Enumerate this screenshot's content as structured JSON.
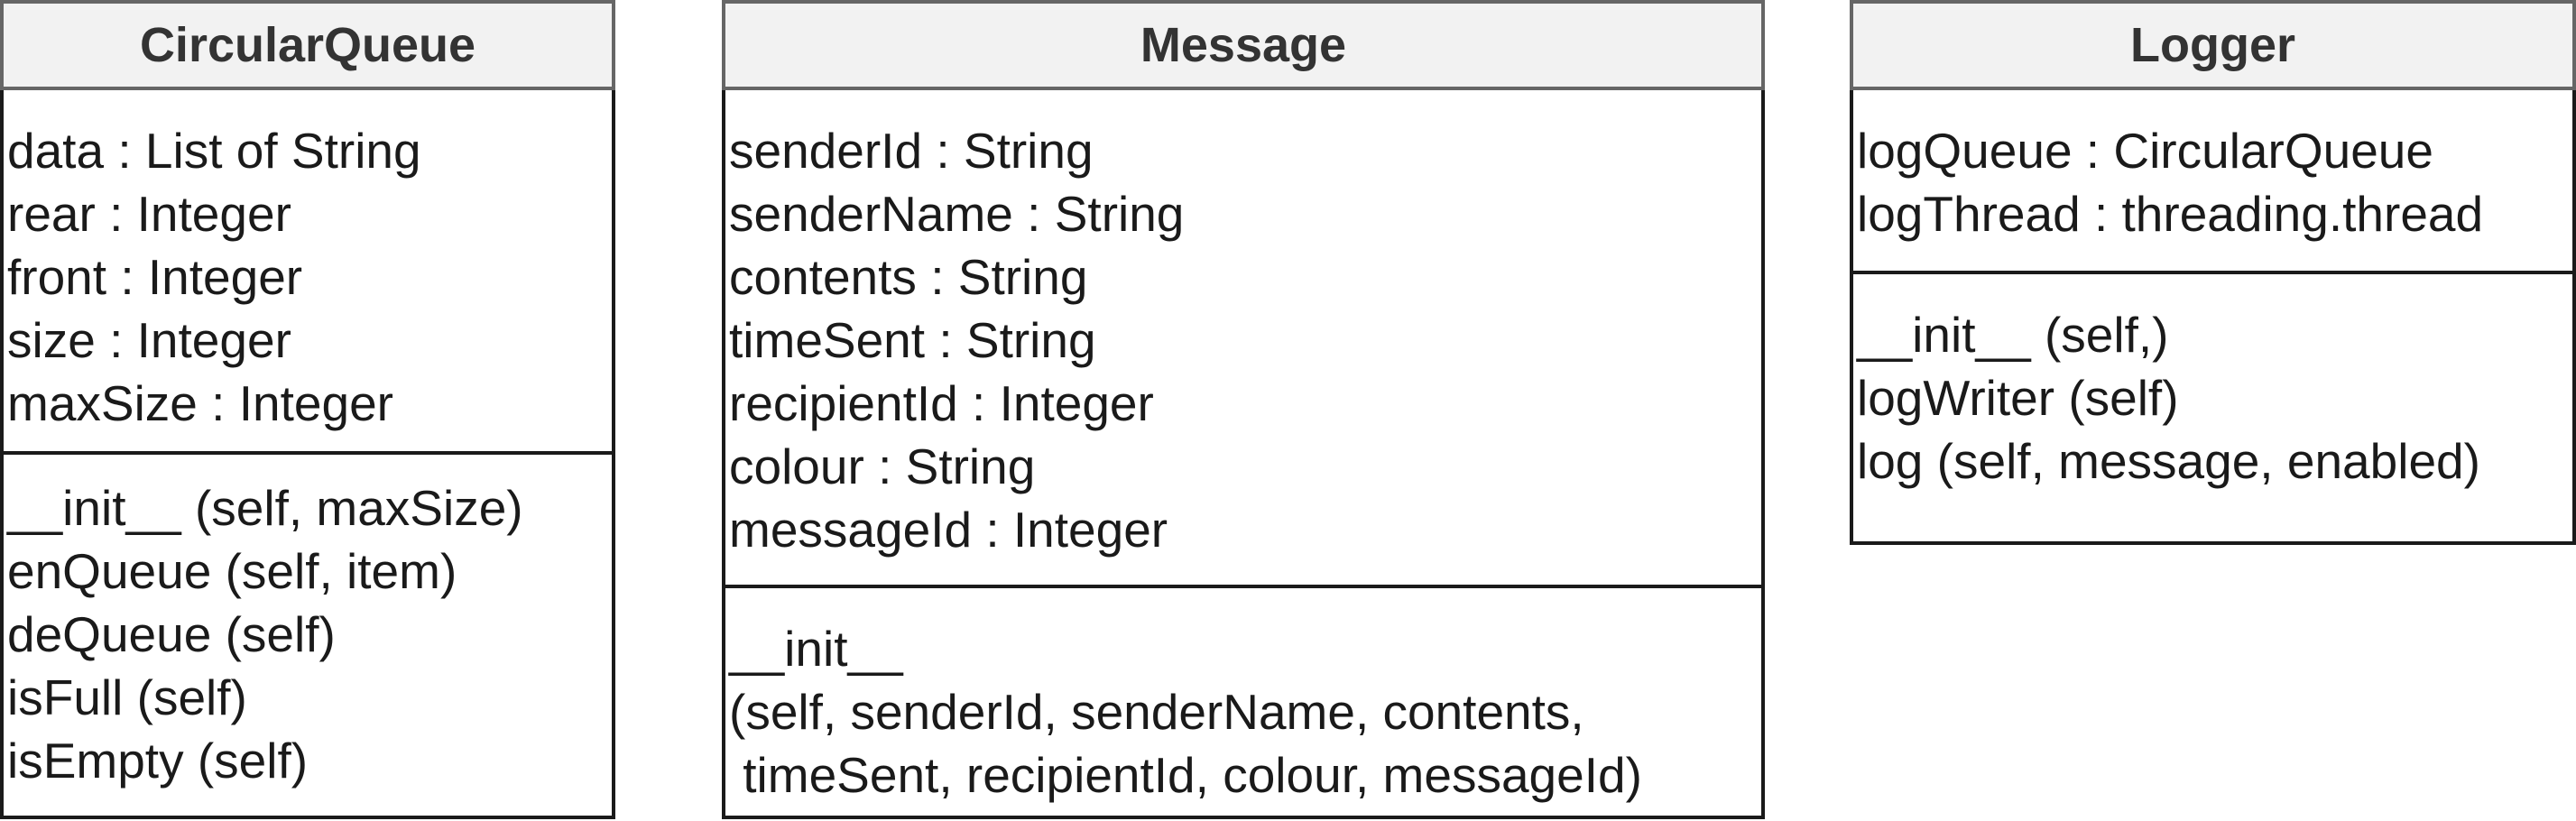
{
  "classes": [
    {
      "name": "CircularQueue",
      "attributes": [
        "data : List of String",
        "rear : Integer",
        "front : Integer",
        "size : Integer",
        "maxSize : Integer"
      ],
      "methods": [
        "__init__ (self, maxSize)",
        "enQueue (self, item)",
        "deQueue (self)",
        "isFull (self)",
        "isEmpty (self)"
      ]
    },
    {
      "name": "Message",
      "attributes": [
        "senderId : String",
        "senderName : String",
        "contents : String",
        "timeSent : String",
        "recipientId : Integer",
        "colour : String",
        "messageId : Integer"
      ],
      "methods": [
        "__init__",
        "(self, senderId, senderName, contents,",
        " timeSent, recipientId, colour, messageId)"
      ]
    },
    {
      "name": "Logger",
      "attributes": [
        "logQueue : CircularQueue",
        "logThread : threading.thread"
      ],
      "methods": [
        "__init__ (self,)",
        "logWriter (self)",
        "log (self, message, enabled)"
      ]
    }
  ]
}
